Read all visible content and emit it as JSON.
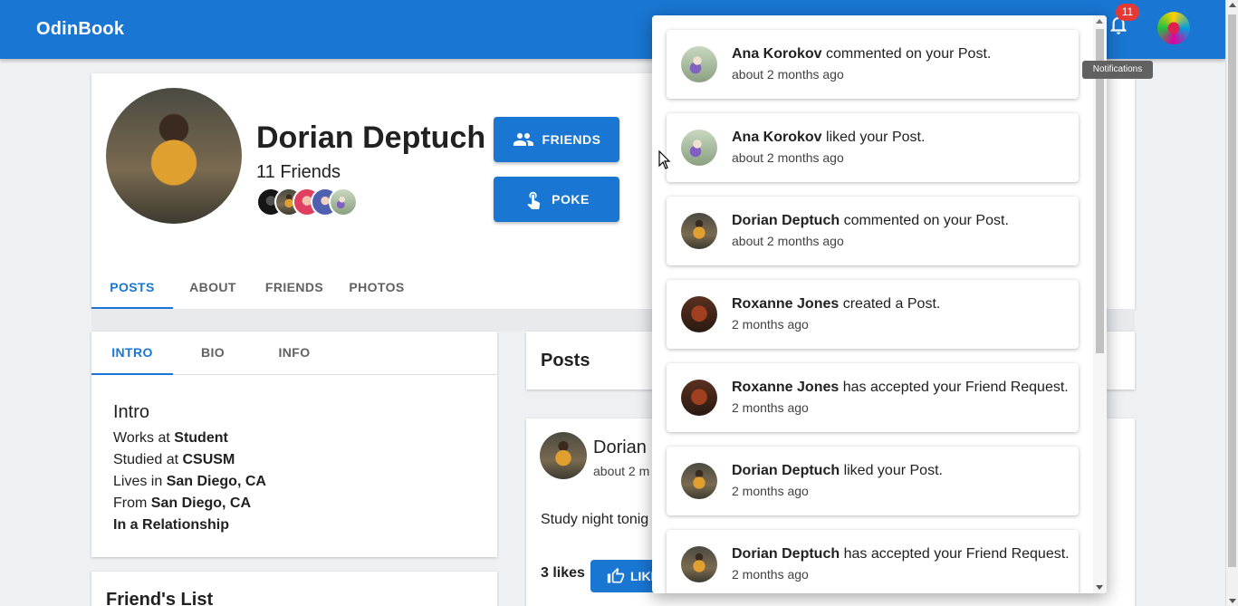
{
  "app": {
    "title": "OdinBook"
  },
  "header": {
    "notification_count": "11",
    "tooltip": "Notifications"
  },
  "profile": {
    "name": "Dorian Deptuch",
    "friends_count": "11 Friends",
    "buttons": {
      "friends": "FRIENDS",
      "poke": "POKE"
    },
    "tabs": [
      "POSTS",
      "ABOUT",
      "FRIENDS",
      "PHOTOS"
    ]
  },
  "intro": {
    "tabs": [
      "INTRO",
      "BIO",
      "INFO"
    ],
    "title": "Intro",
    "works_prefix": "Works at ",
    "works": "Student",
    "studied_prefix": "Studied at ",
    "studied": "CSUSM",
    "lives_prefix": "Lives in ",
    "lives": "San Diego, CA",
    "from_prefix": "From ",
    "from": "San Diego, CA",
    "relationship": "In a Relationship"
  },
  "friend_list": {
    "title": "Friend's List"
  },
  "posts": {
    "title": "Posts",
    "post": {
      "author": "Dorian",
      "time": "about 2 m",
      "text": "Study night tonig",
      "likes": "3 likes",
      "like_label": "LIKE"
    }
  },
  "notifications": [
    {
      "name": "Ana Korokov",
      "action": " commented on your Post.",
      "time": "about 2 months ago",
      "avatar": "ana"
    },
    {
      "name": "Ana Korokov",
      "action": " liked your Post.",
      "time": "about 2 months ago",
      "avatar": "ana"
    },
    {
      "name": "Dorian Deptuch",
      "action": " commented on your Post.",
      "time": "about 2 months ago",
      "avatar": "dorian"
    },
    {
      "name": "Roxanne Jones",
      "action": " created a Post.",
      "time": "2 months ago",
      "avatar": "roxanne"
    },
    {
      "name": "Roxanne Jones",
      "action": " has accepted your Friend Request.",
      "time": "2 months ago",
      "avatar": "roxanne"
    },
    {
      "name": "Dorian Deptuch",
      "action": " liked your Post.",
      "time": "2 months ago",
      "avatar": "dorian"
    },
    {
      "name": "Dorian Deptuch",
      "action": " has accepted your Friend Request.",
      "time": "2 months ago",
      "avatar": "dorian"
    }
  ],
  "colors": {
    "primary": "#1976d2",
    "badge": "#e53935",
    "background": "#eef0f3"
  }
}
